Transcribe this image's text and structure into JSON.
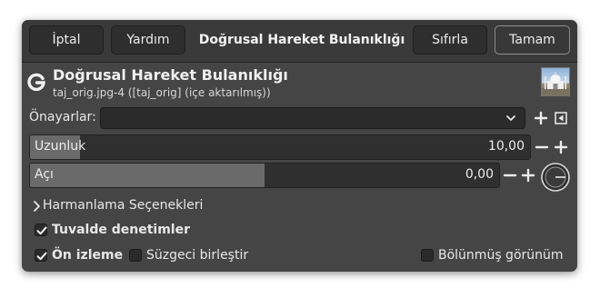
{
  "header": {
    "cancel_label": "İptal",
    "help_label": "Yardım",
    "title": "Doğrusal Hareket Bulanıklığı",
    "reset_label": "Sıfırla",
    "ok_label": "Tamam"
  },
  "filter": {
    "icon": "gegl-g-icon",
    "name": "Doğrusal Hareket Bulanıklığı",
    "subtitle": "taj_orig.jpg-4 ([taj_orig] (içe aktarılmış))"
  },
  "presets": {
    "label": "Önayarlar:",
    "value": ""
  },
  "sliders": [
    {
      "label": "Uzunluk",
      "value": "10,00",
      "fill_fraction": 0.1
    },
    {
      "label": "Açı",
      "value": "0,00",
      "fill_fraction": 0.5
    }
  ],
  "blending_label": "Harmanlama Seçenekleri",
  "canvas_controls": {
    "label": "Tuvalde denetimler",
    "checked": true
  },
  "preview": {
    "label": "Ön izleme",
    "checked": true
  },
  "merge_filter": {
    "label": "Süzgeci birleştir",
    "checked": false
  },
  "split_view": {
    "label": "Bölünmüş görünüm",
    "checked": false
  }
}
